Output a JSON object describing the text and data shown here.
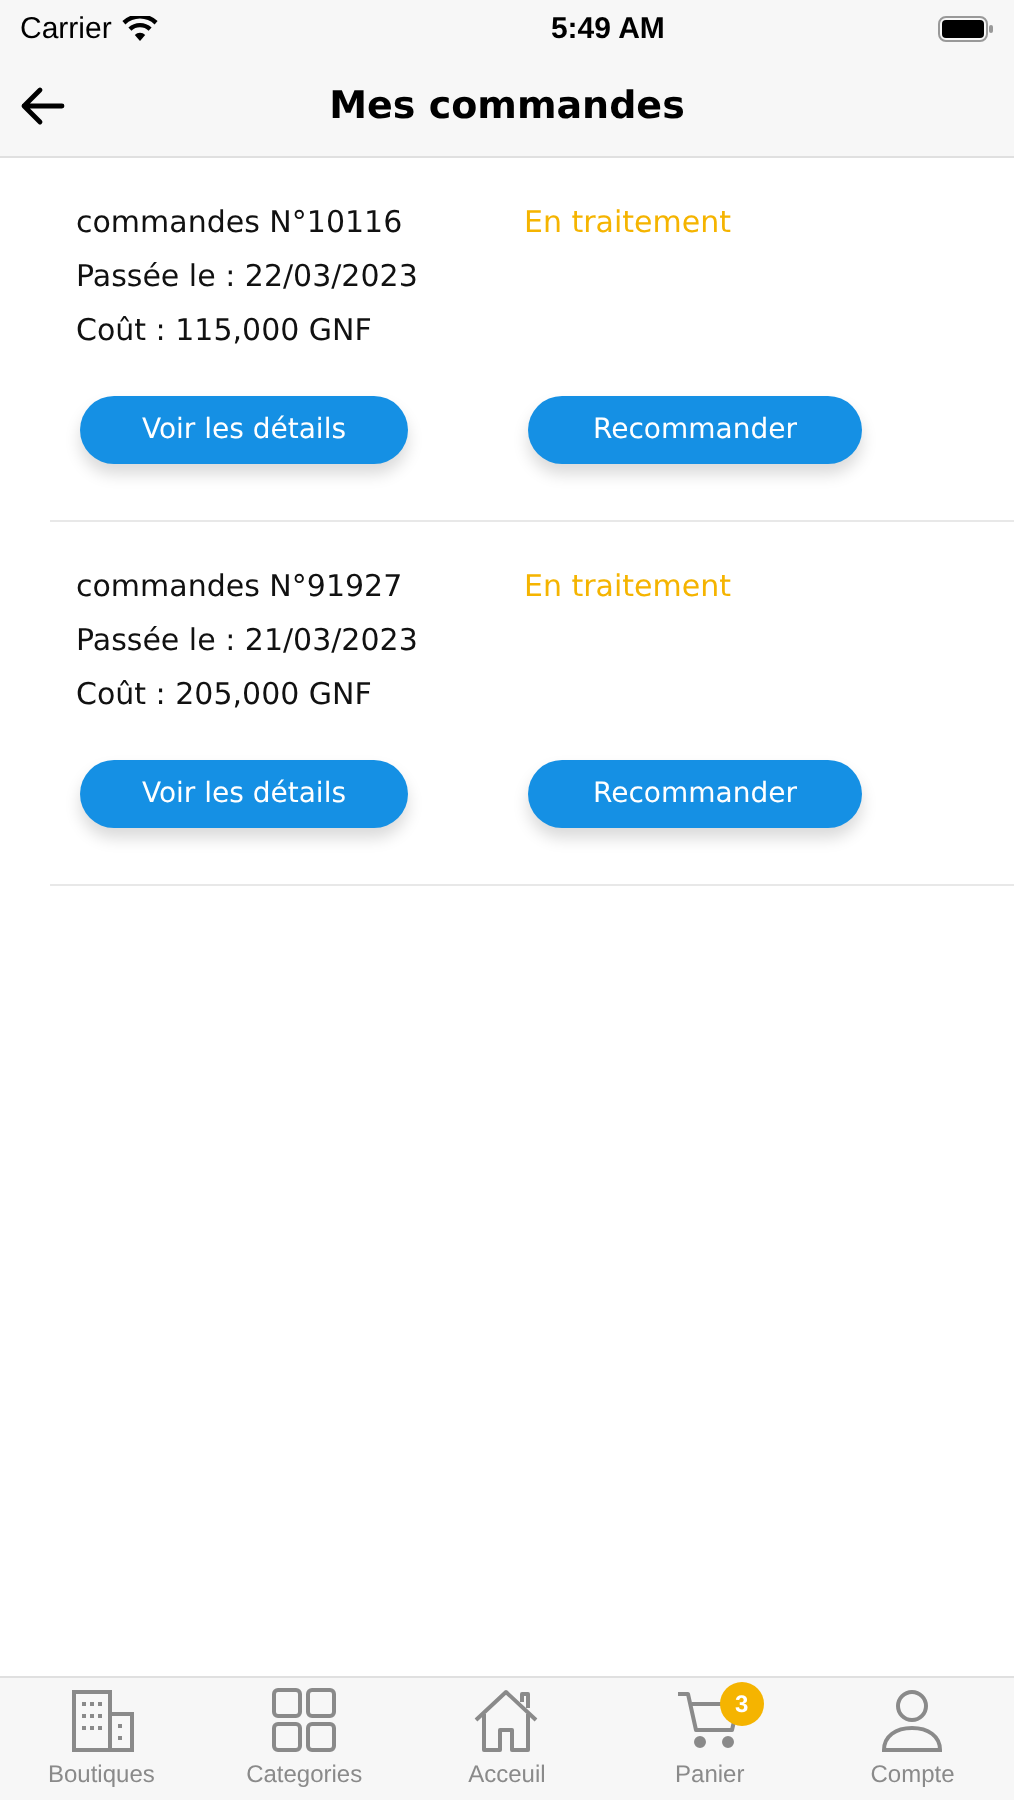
{
  "status_bar": {
    "carrier": "Carrier",
    "time": "5:49 AM"
  },
  "header": {
    "title": "Mes commandes"
  },
  "orders": [
    {
      "number": "commandes N°10116",
      "status": "En traitement",
      "date": "Passée le : 22/03/2023",
      "cost": "Coût : 115,000 GNF",
      "buttons": [
        "Voir les détails",
        "Recommander"
      ]
    },
    {
      "number": "commandes N°91927",
      "status": "En traitement",
      "date": "Passée le : 21/03/2023",
      "cost": "Coût : 205,000 GNF",
      "buttons": [
        "Voir les détails",
        "Recommander"
      ]
    }
  ],
  "tab_bar": [
    {
      "kind": "shops",
      "label": "Boutiques"
    },
    {
      "kind": "categories",
      "label": "Categories"
    },
    {
      "kind": "home",
      "label": "Acceuil"
    },
    {
      "kind": "cart",
      "label": "Panier",
      "badge": "3"
    },
    {
      "kind": "account",
      "label": "Compte"
    }
  ]
}
